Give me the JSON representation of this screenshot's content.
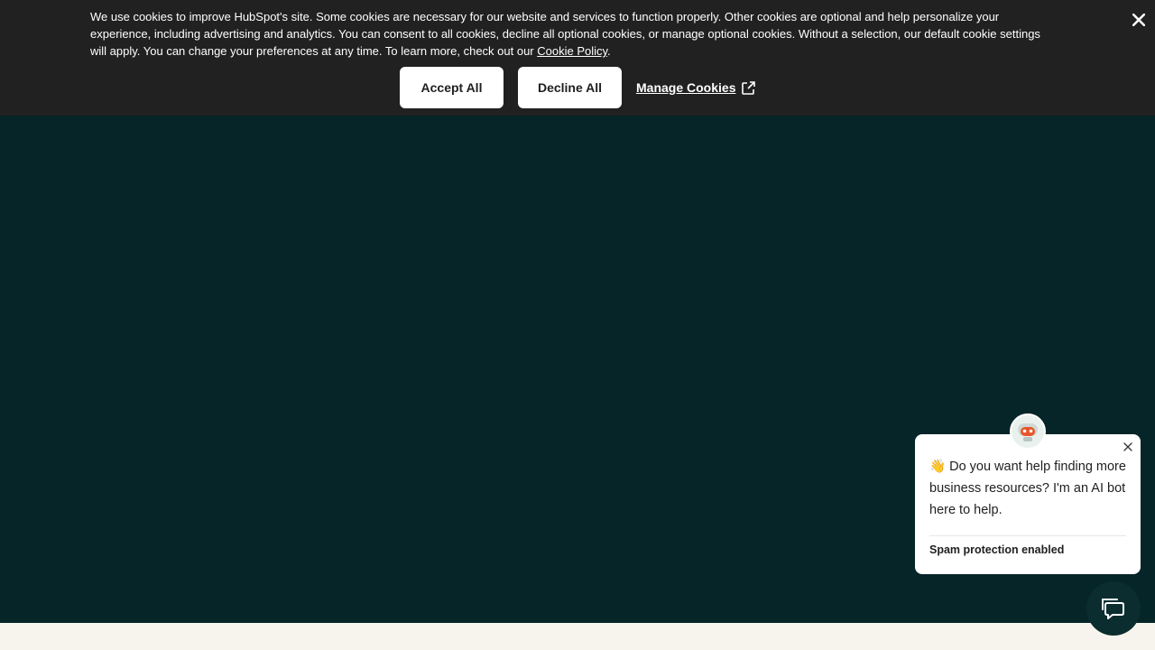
{
  "cookie_banner": {
    "text": "We use cookies to improve HubSpot's site. Some cookies are necessary for our website and services to function properly. Other cookies are optional and help personalize your experience, including advertising and analytics. You can consent to all cookies, decline all optional cookies, or manage optional cookies. Without a selection, our default cookie settings will apply. You can change your preferences at any time. To learn more, check out our ",
    "policy_link": "Cookie Policy",
    "after_link": ".",
    "accept_label": "Accept All",
    "decline_label": "Decline All",
    "manage_label": "Manage Cookies",
    "close_icon": "close-icon",
    "external_icon": "external-link-icon"
  },
  "chat": {
    "emoji": "👋",
    "message": " Do you want help finding more business resources? I'm an AI bot here to help.",
    "spam_text": "Spam protection enabled",
    "avatar_icon": "robot-icon",
    "close_icon": "close-icon",
    "launcher_icon": "chat-bubble-icon"
  },
  "colors": {
    "banner_bg": "#212121",
    "hero_bg": "#052528",
    "footer_bg": "#f7f4ee",
    "robot_accent": "#e8552a"
  }
}
